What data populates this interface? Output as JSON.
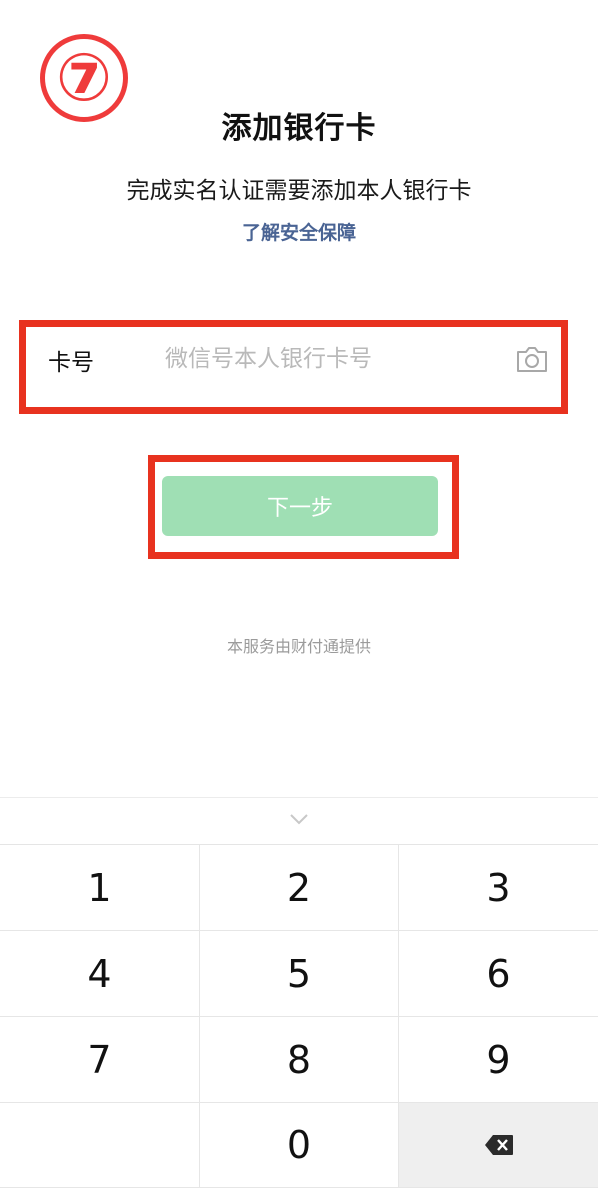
{
  "step_badge": "⑦",
  "header": {
    "title": "添加银行卡",
    "subtitle": "完成实名认证需要添加本人银行卡",
    "security_link": "了解安全保障"
  },
  "card_field": {
    "label": "卡号",
    "value": "",
    "placeholder": "微信号本人银行卡号",
    "camera_icon": "camera-icon"
  },
  "next_button": {
    "label": "下一步"
  },
  "footer_note": "本服务由财付通提供",
  "keyboard": {
    "collapse_icon": "chevron-down-icon",
    "keys": [
      "1",
      "2",
      "3",
      "4",
      "5",
      "6",
      "7",
      "8",
      "9",
      "",
      "0"
    ],
    "delete_icon": "backspace-icon"
  },
  "colors": {
    "highlight_red": "#e8321f",
    "button_green": "#9fdfb4",
    "link_blue": "#4a6494"
  }
}
